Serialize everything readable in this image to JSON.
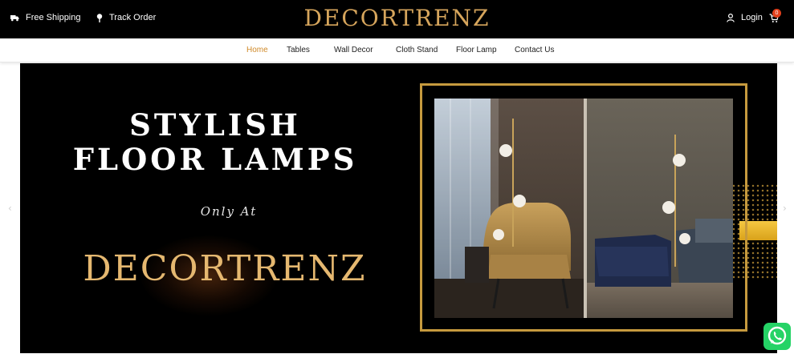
{
  "topbar": {
    "free_shipping": "Free Shipping",
    "track_order": "Track Order",
    "brand": "DECORTRENZ",
    "login": "Login",
    "cart_count": "0"
  },
  "nav": {
    "items": [
      {
        "label": "Home",
        "active": true
      },
      {
        "label": "Tables",
        "active": false
      },
      {
        "label": "Wall Decor",
        "active": false
      },
      {
        "label": "Cloth Stand",
        "active": false
      },
      {
        "label": "Floor Lamp",
        "active": false
      },
      {
        "label": "Contact Us",
        "active": false
      }
    ]
  },
  "hero": {
    "title_line1": "STYLISH",
    "title_line2": "FLOOR LAMPS",
    "subtitle": "Only At",
    "brand": "DECORTRENZ",
    "prev_arrow": "‹",
    "next_arrow": "›"
  },
  "icons": {
    "shipping": "truck-icon",
    "track": "map-pin-icon",
    "login": "user-icon",
    "cart": "cart-icon",
    "whatsapp": "whatsapp-icon"
  },
  "colors": {
    "brand_gold": "#d6a55c",
    "nav_active": "#d08a2a",
    "frame_gold": "#c69a3e",
    "whatsapp_green": "#25d366"
  }
}
